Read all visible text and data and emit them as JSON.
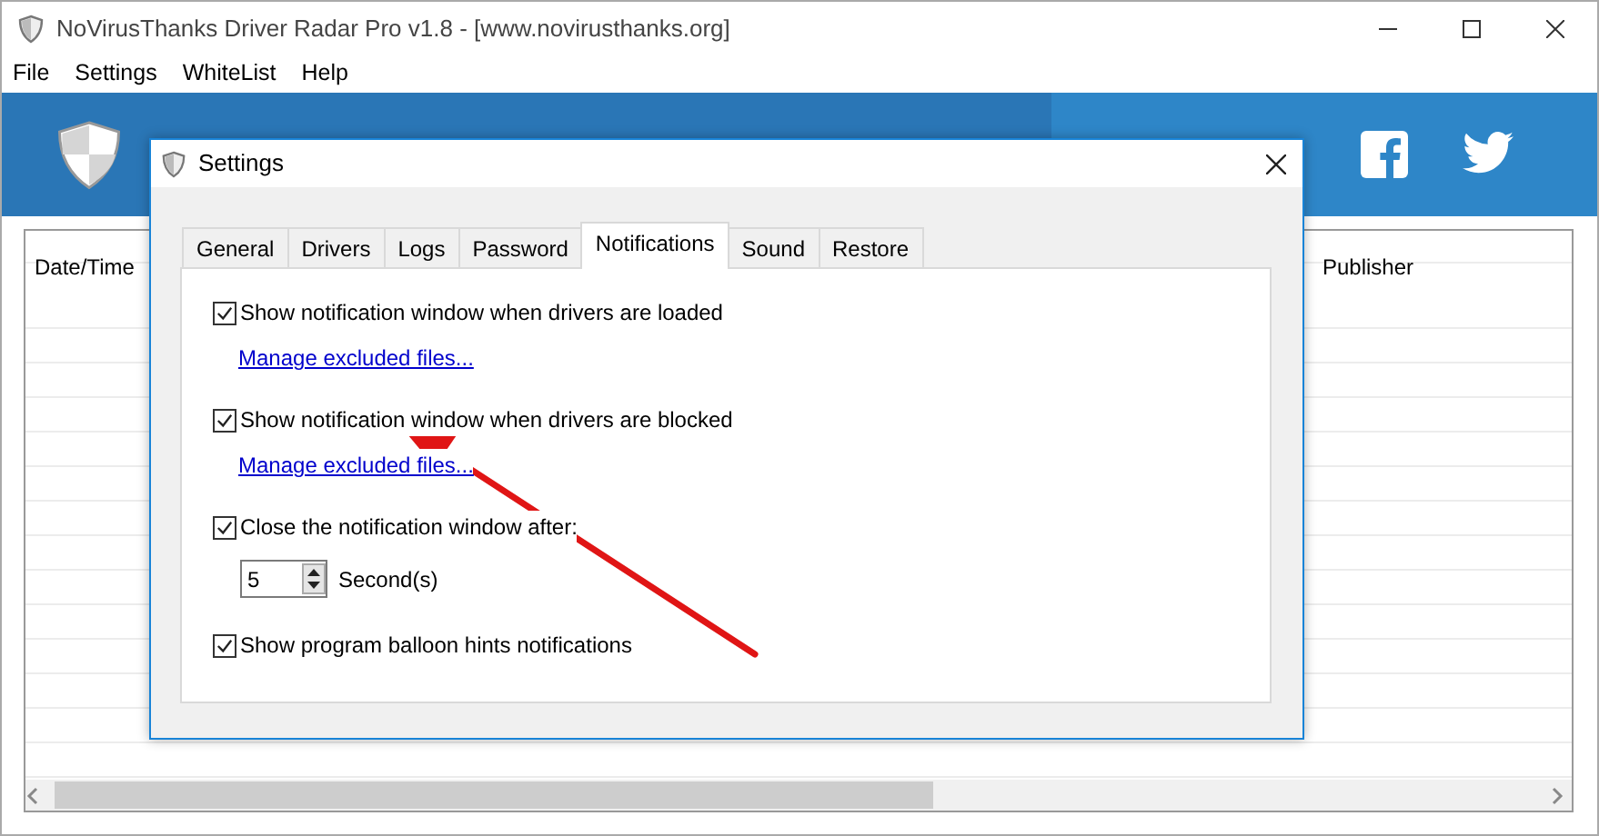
{
  "window": {
    "title": "NoVirusThanks Driver Radar Pro v1.8 - [www.novirusthanks.org]"
  },
  "menu": [
    {
      "label": "File"
    },
    {
      "label": "Settings"
    },
    {
      "label": "WhiteList"
    },
    {
      "label": "Help"
    }
  ],
  "table": {
    "columns": [
      {
        "label": "Date/Time"
      },
      {
        "label": "Publisher"
      }
    ]
  },
  "dialog": {
    "title": "Settings",
    "tabs": [
      {
        "label": "General",
        "selected": false
      },
      {
        "label": "Drivers",
        "selected": false
      },
      {
        "label": "Logs",
        "selected": false
      },
      {
        "label": "Password",
        "selected": false
      },
      {
        "label": "Notifications",
        "selected": true
      },
      {
        "label": "Sound",
        "selected": false
      },
      {
        "label": "Restore",
        "selected": false
      }
    ],
    "options": [
      {
        "kind": "checkbox",
        "label": "Show notification window when drivers are loaded",
        "checked": true
      },
      {
        "kind": "link",
        "label": "Manage excluded files..."
      },
      {
        "kind": "checkbox",
        "label": "Show notification window when drivers are blocked",
        "checked": true
      },
      {
        "kind": "link",
        "label": "Manage excluded files..."
      },
      {
        "kind": "checkbox",
        "label": "Close the notification window after:",
        "checked": true
      },
      {
        "kind": "spinner",
        "value": "5",
        "unit": "Second(s)"
      },
      {
        "kind": "checkbox",
        "label": "Show program balloon hints notifications",
        "checked": true
      }
    ]
  }
}
